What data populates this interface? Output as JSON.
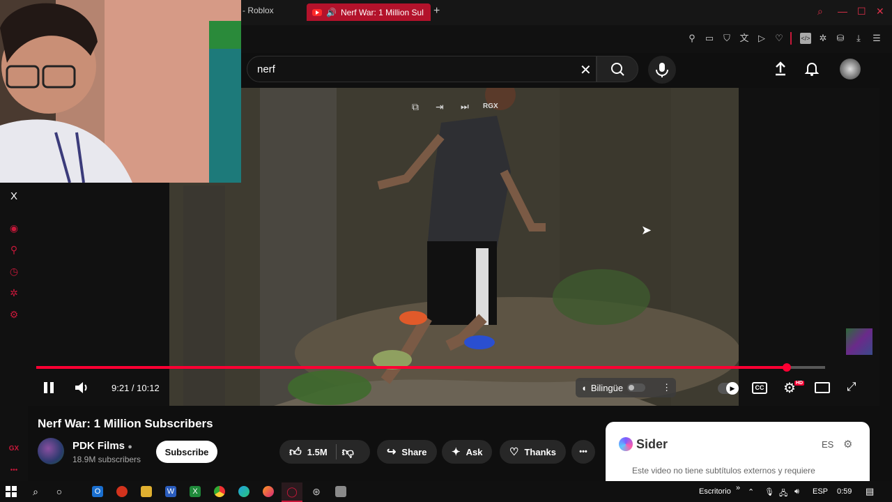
{
  "browser": {
    "prev_tab_title": "- Roblox",
    "active_tab_title": "Nerf War: 1 Million Sul",
    "new_tab": "+"
  },
  "search": {
    "value": "nerf",
    "clear_icon": "close-icon",
    "search_icon": "search-icon",
    "mic_icon": "mic-icon"
  },
  "header": {
    "upload_icon": "upload-icon",
    "notifications_icon": "bell-icon",
    "avatar_icon": "avatar"
  },
  "player": {
    "overlay_label": "RGX",
    "time": "9:21 / 10:12",
    "progress_fraction": 0.978,
    "buffered_fraction": 1.0,
    "bilingual_label": "Bilingüe",
    "captions_label": "CC",
    "hd_badge": "HD"
  },
  "video": {
    "title": "Nerf War: 1 Million Subscribers",
    "channel": "PDK Films",
    "subscribers": "18.9M subscribers",
    "subscribe_label": "Subscribe",
    "likes": "1.5M",
    "share_label": "Share",
    "ask_label": "Ask",
    "thanks_label": "Thanks",
    "more_label": "•••"
  },
  "sider": {
    "name": "Sider",
    "lang": "ES",
    "message": "Este video no tiene subtítulos externos y requiere"
  },
  "sidebar": {
    "x_label": "X",
    "gx_label": "GX",
    "more_label": "•••"
  },
  "taskbar": {
    "desktop_label": "Escritorio",
    "chevrons": "»",
    "lang": "ESP",
    "clock": "0:59"
  },
  "colors": {
    "accent": "#ff0033",
    "opera_red": "#c8183a",
    "tab_active": "#b3122b"
  }
}
